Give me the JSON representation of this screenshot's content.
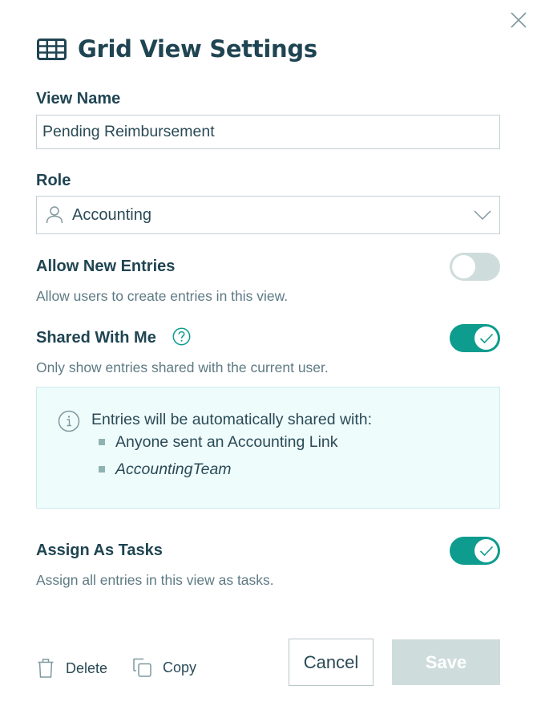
{
  "dialog": {
    "title": "Grid View Settings",
    "title_icon": "grid-table-icon",
    "close_icon": "close-icon"
  },
  "view_name": {
    "label": "View Name",
    "value": "Pending Reimbursement",
    "placeholder": ""
  },
  "role": {
    "label": "Role",
    "value": "Accounting",
    "icon": "person-icon",
    "dropdown_icon": "chevron-down-icon"
  },
  "allow_new_entries": {
    "label": "Allow New Entries",
    "description": "Allow users to create entries in this view.",
    "enabled": false
  },
  "shared_with_me": {
    "label": "Shared With Me",
    "help_icon": "question-circle-icon",
    "description": "Only show entries shared with the current user.",
    "enabled": true,
    "info": {
      "icon": "info-circle-icon",
      "title": "Entries will be automatically shared with:",
      "items": [
        {
          "text": "Anyone sent an Accounting Link",
          "italic": false
        },
        {
          "text": "AccountingTeam",
          "italic": true
        }
      ]
    }
  },
  "assign_as_tasks": {
    "label": "Assign As Tasks",
    "description": "Assign all entries in this view as tasks.",
    "enabled": true
  },
  "footer": {
    "delete_label": "Delete",
    "copy_label": "Copy",
    "cancel_label": "Cancel",
    "save_label": "Save",
    "save_disabled": true
  },
  "colors": {
    "text_primary": "#1f4452",
    "text_secondary": "#5e7a84",
    "accent": "#0e9c8e",
    "toggle_off": "#cfdcdc",
    "info_bg": "#effcfc",
    "disabled_button": "#cfdcdc"
  }
}
